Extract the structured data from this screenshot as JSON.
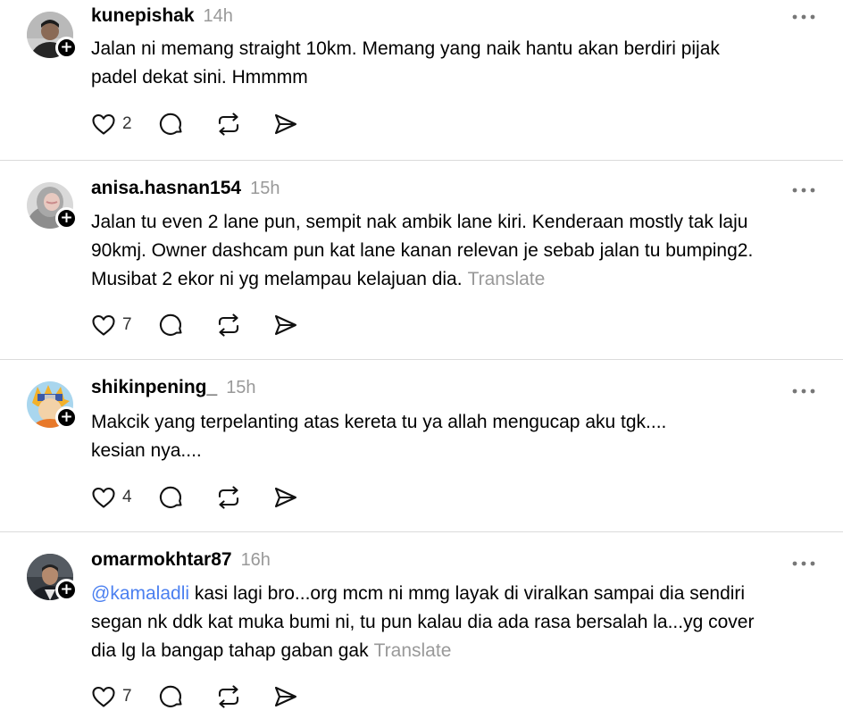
{
  "posts": [
    {
      "username": "kunepishak",
      "time": "14h",
      "text_lines": [
        "Jalan ni memang straight 10km. Memang yang naik hantu akan berdiri pijak",
        "padel dekat sini. Hmmmm"
      ],
      "likes": "2"
    },
    {
      "username": "anisa.hasnan154",
      "time": "15h",
      "text_lines": [
        "Jalan tu even 2 lane pun, sempit nak ambik lane kiri. Kenderaan mostly tak laju",
        "90kmj. Owner dashcam pun kat lane kanan relevan je sebab jalan tu bumping2.",
        "Musibat 2 ekor ni yg melampau kelajuan dia."
      ],
      "translate": "Translate",
      "likes": "7"
    },
    {
      "username": "shikinpening_",
      "time": "15h",
      "text_lines": [
        "Makcik yang terpelanting atas kereta tu ya allah mengucap aku tgk....",
        "kesian nya...."
      ],
      "likes": "4"
    },
    {
      "username": "omarmokhtar87",
      "time": "16h",
      "mention": "@kamaladli",
      "text_lines": [
        " kasi lagi bro...org mcm ni mmg layak di viralkan sampai dia sendiri",
        "segan nk ddk kat muka bumi ni, tu pun kalau dia ada rasa bersalah la...yg cover",
        "dia lg la bangap tahap gaban gak"
      ],
      "translate": "Translate",
      "likes": "7"
    }
  ],
  "icons": {
    "more": "more-horizontal-icon",
    "follow": "plus-icon",
    "like": "heart-icon",
    "reply": "comment-icon",
    "repost": "repost-icon",
    "share": "send-icon"
  },
  "colors": {
    "text": "#000000",
    "muted": "#999999",
    "mention": "#4a7ff0",
    "divider": "#dbdbdb"
  }
}
